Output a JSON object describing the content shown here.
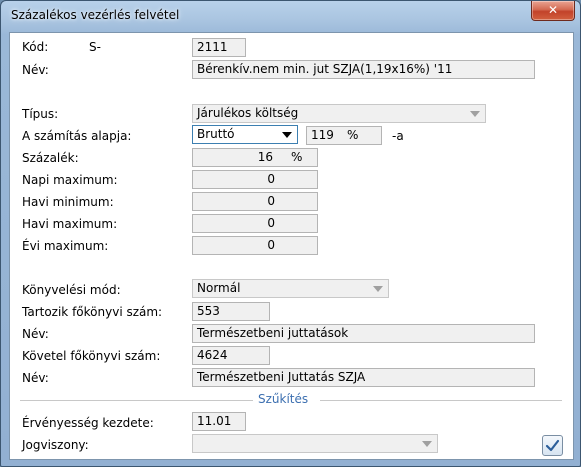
{
  "window": {
    "title": "Százalékos vezérlés felvétel"
  },
  "titlebar": {
    "close_glyph": "✕"
  },
  "form": {
    "kod_label": "Kód:",
    "kod_prefix": "S-",
    "kod_value": "2111",
    "nev_label": "Név:",
    "nev_value": "Bérenkív.nem min. jut SZJA(1,19x16%) '11",
    "tipus_label": "Típus:",
    "tipus_value": "Járulékos költség",
    "alap_label": "A számítás alapja:",
    "alap_value": "Bruttó",
    "alap_percent_value": "119",
    "alap_percent_unit": "%",
    "alap_suffix": "-a",
    "szazalek_label": "Százalék:",
    "szazalek_value": "16",
    "szazalek_unit": "%",
    "napi_max_label": "Napi maximum:",
    "napi_max_value": "0",
    "havi_min_label": "Havi minimum:",
    "havi_min_value": "0",
    "havi_max_label": "Havi maximum:",
    "havi_max_value": "0",
    "evi_max_label": "Évi maximum:",
    "evi_max_value": "0",
    "konyv_mod_label": "Könyvelési mód:",
    "konyv_mod_value": "Normál",
    "tartozik_label": "Tartozik főkönyvi szám:",
    "tartozik_value": "553",
    "tartozik_nev_label": "Név:",
    "tartozik_nev_value": "Természetbeni juttatások",
    "kovetel_label": "Követel főkönyvi szám:",
    "kovetel_value": "4624",
    "kovetel_nev_label": "Név:",
    "kovetel_nev_value": "Természetbeni Juttatás SZJA"
  },
  "szukites": {
    "title": "Szűkítés",
    "ervenyesseg_label": "Érvényesség kezdete:",
    "ervenyesseg_value": "11.01",
    "jogviszony_label": "Jogviszony:",
    "jogviszony_value": ""
  },
  "icons": {
    "ok": "checkmark-icon",
    "close": "close-icon",
    "dropdown": "chevron-down-icon"
  },
  "colors": {
    "accent": "#3c6fb0",
    "close_button": "#c2422a",
    "field_bg": "#f0f0f0"
  }
}
